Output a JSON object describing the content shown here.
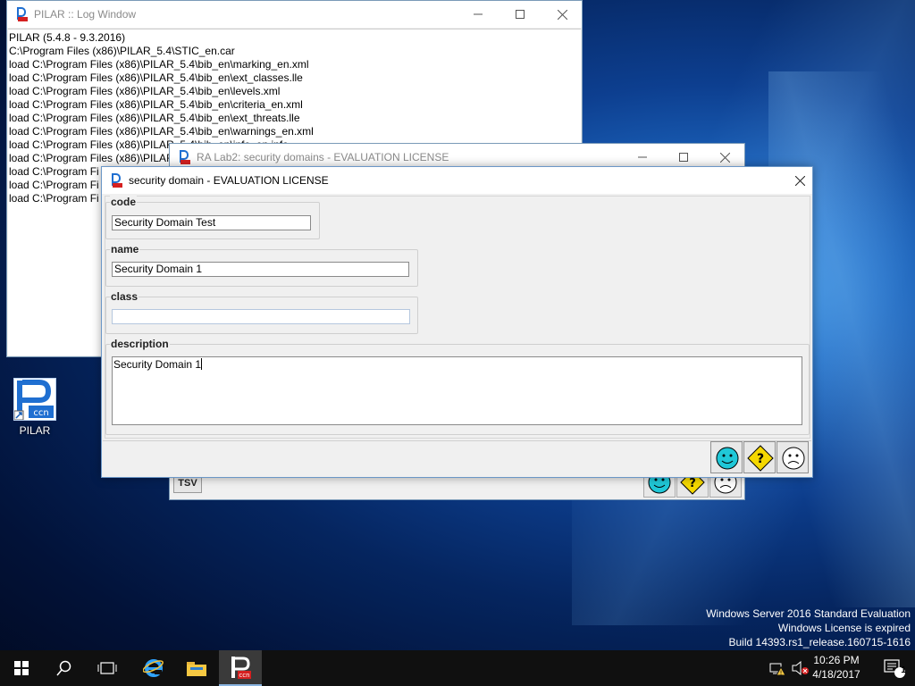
{
  "log_window": {
    "title": "PILAR :: Log Window",
    "lines": [
      "PILAR (5.4.8 - 9.3.2016)",
      "C:\\Program Files (x86)\\PILAR_5.4\\STIC_en.car",
      "load C:\\Program Files (x86)\\PILAR_5.4\\bib_en\\marking_en.xml",
      "load C:\\Program Files (x86)\\PILAR_5.4\\bib_en\\ext_classes.lle",
      "load C:\\Program Files (x86)\\PILAR_5.4\\bib_en\\levels.xml",
      "load C:\\Program Files (x86)\\PILAR_5.4\\bib_en\\criteria_en.xml",
      "load C:\\Program Files (x86)\\PILAR_5.4\\bib_en\\ext_threats.lle",
      "load C:\\Program Files (x86)\\PILAR_5.4\\bib_en\\warnings_en.xml",
      "load C:\\Program Files (x86)\\PILAR_5.4\\bib_en\\info_en.info",
      "load C:\\Program Files (x86)\\PILAR",
      "load C:\\Program Fi",
      "load C:\\Program Fi",
      "load C:\\Program Fi"
    ]
  },
  "ra_window": {
    "title": "RA Lab2: security domains - EVALUATION LICENSE",
    "tsv_label": "TSV"
  },
  "dialog": {
    "title": "security domain - EVALUATION LICENSE",
    "code_label": "code",
    "code_value": "Security Domain Test",
    "name_label": "name",
    "name_value": "Security Domain 1",
    "class_label": "class",
    "class_value": "",
    "description_label": "description",
    "description_value": "Security Domain 1",
    "buttons": [
      "ok-smiley",
      "help-question",
      "cancel-sad"
    ]
  },
  "desktop": {
    "icon_label": "PILAR",
    "watermark": [
      "Windows Server 2016 Standard Evaluation",
      "Windows License is expired",
      "Build 14393.rs1_release.160715-1616"
    ]
  },
  "taskbar": {
    "time": "10:26 PM",
    "date": "4/18/2017",
    "notification_count": "1"
  },
  "colors": {
    "accent": "#1f6fd1",
    "smiley_face": "#20c8d8",
    "help_diamond": "#f5d800"
  }
}
